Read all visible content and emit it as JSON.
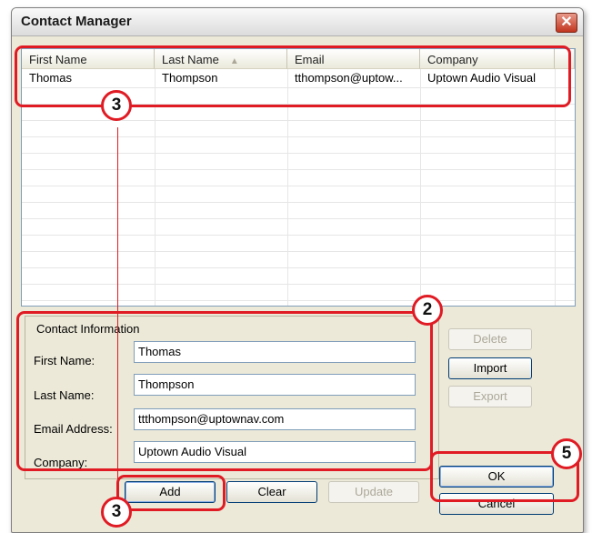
{
  "window": {
    "title": "Contact Manager",
    "close_glyph": "✕"
  },
  "list": {
    "columns": [
      "First Name",
      "Last Name",
      "Email",
      "Company"
    ],
    "sort_indicator": "▲",
    "rows": [
      [
        "Thomas",
        "Thompson",
        "tthompson@uptow...",
        "Uptown Audio Visual"
      ]
    ]
  },
  "contact": {
    "legend": "Contact Information",
    "labels": {
      "first": "First Name:",
      "last": "Last Name:",
      "email": "Email Address:",
      "company": "Company:"
    },
    "values": {
      "first": "Thomas",
      "last": "Thompson",
      "email": "ttthompson@uptownav.com",
      "company": "Uptown Audio Visual"
    }
  },
  "buttons": {
    "delete": "Delete",
    "import": "Import",
    "export": "Export",
    "add": "Add",
    "clear": "Clear",
    "update": "Update",
    "ok": "OK",
    "cancel": "Cancel"
  },
  "callouts": {
    "list": "3",
    "contact": "2",
    "add": "3",
    "ok": "5"
  },
  "colors": {
    "callout": "#e01b24"
  }
}
